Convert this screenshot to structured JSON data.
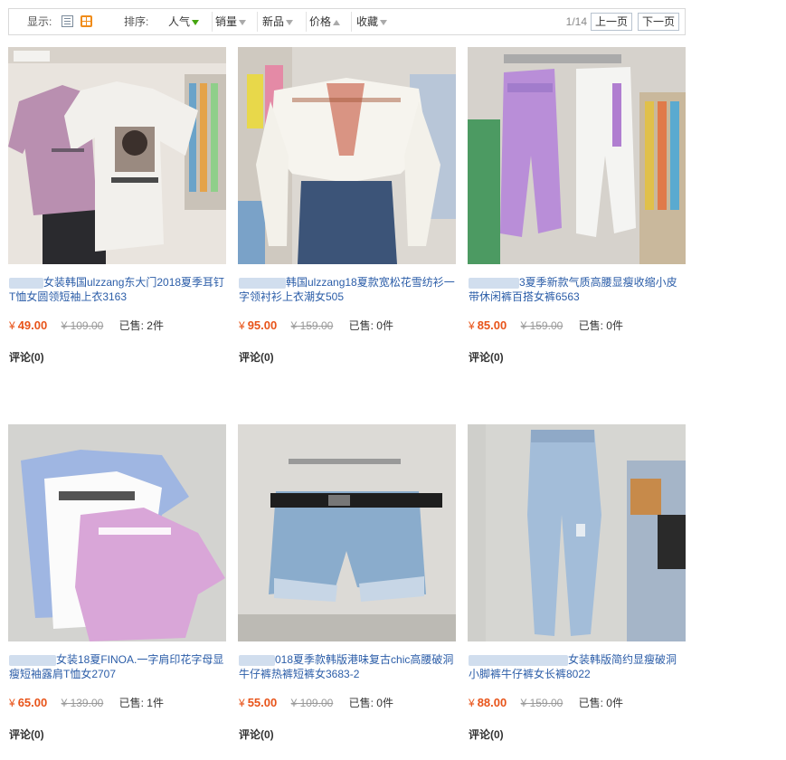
{
  "toolbar": {
    "display_label": "显示:",
    "sort_label": "排序:",
    "sorts": [
      {
        "label": "人气",
        "arrow": "down-active"
      },
      {
        "label": "销量",
        "arrow": "down"
      },
      {
        "label": "新品",
        "arrow": "down"
      },
      {
        "label": "价格",
        "arrow": "up"
      },
      {
        "label": "收藏",
        "arrow": "down"
      }
    ],
    "page_indicator": "1/14",
    "prev_label": "上一页",
    "next_label": "下一页"
  },
  "products": [
    {
      "title": "女装韩国ulzzang东大门2018夏季耳钉T恤女圆领短袖上衣3163",
      "price": "49.00",
      "original_price": "¥ 109.00",
      "sold": "已售: 2件",
      "comments": "评论(0)",
      "currency": "¥"
    },
    {
      "title": "韩国ulzzang18夏款宽松花雪纺衫一字领衬衫上衣潮女505",
      "price": "95.00",
      "original_price": "¥ 159.00",
      "sold": "已售: 0件",
      "comments": "评论(0)",
      "currency": "¥"
    },
    {
      "title": "3夏季新款气质高腰显瘦收缩小皮带休闲裤百搭女裤6563",
      "price": "85.00",
      "original_price": "¥ 159.00",
      "sold": "已售: 0件",
      "comments": "评论(0)",
      "currency": "¥"
    },
    {
      "title": "女装18夏FINOA.一字肩印花字母显瘦短袖露肩T恤女2707",
      "price": "65.00",
      "original_price": "¥ 139.00",
      "sold": "已售: 1件",
      "comments": "评论(0)",
      "currency": "¥"
    },
    {
      "title": "018夏季款韩版港味复古chic高腰破洞牛仔裤热裤短裤女3683-2",
      "price": "55.00",
      "original_price": "¥ 109.00",
      "sold": "已售: 0件",
      "comments": "评论(0)",
      "currency": "¥"
    },
    {
      "title": "女装韩版简约显瘦破洞小脚裤牛仔裤女长裤8022",
      "price": "88.00",
      "original_price": "¥ 159.00",
      "sold": "已售: 0件",
      "comments": "评论(0)",
      "currency": "¥"
    }
  ],
  "colors": {
    "accent_price": "#e8541a",
    "link": "#2b5da8",
    "sort_active_arrow": "#45a510",
    "grid_icon": "#f08c1a"
  }
}
